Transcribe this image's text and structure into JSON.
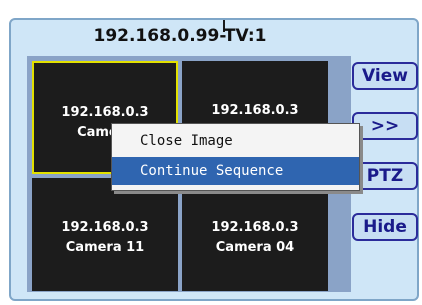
{
  "title": "192.168.0.99-TV:1",
  "cameras": [
    {
      "ip": "192.168.0.3",
      "name": "Camera"
    },
    {
      "ip": "192.168.0.3",
      "name": ""
    },
    {
      "ip": "192.168.0.3",
      "name": "Camera 11"
    },
    {
      "ip": "192.168.0.3",
      "name": "Camera 04"
    }
  ],
  "buttons": {
    "view": "View",
    "next": ">>",
    "ptz": "PTZ",
    "hide": "Hide"
  },
  "context_menu": {
    "items": [
      "Close Image",
      "Continue Sequence"
    ]
  },
  "colors": {
    "panel": "#cfe6f7",
    "highlight": "#2f65b0",
    "selected_border": "#e2e000"
  }
}
